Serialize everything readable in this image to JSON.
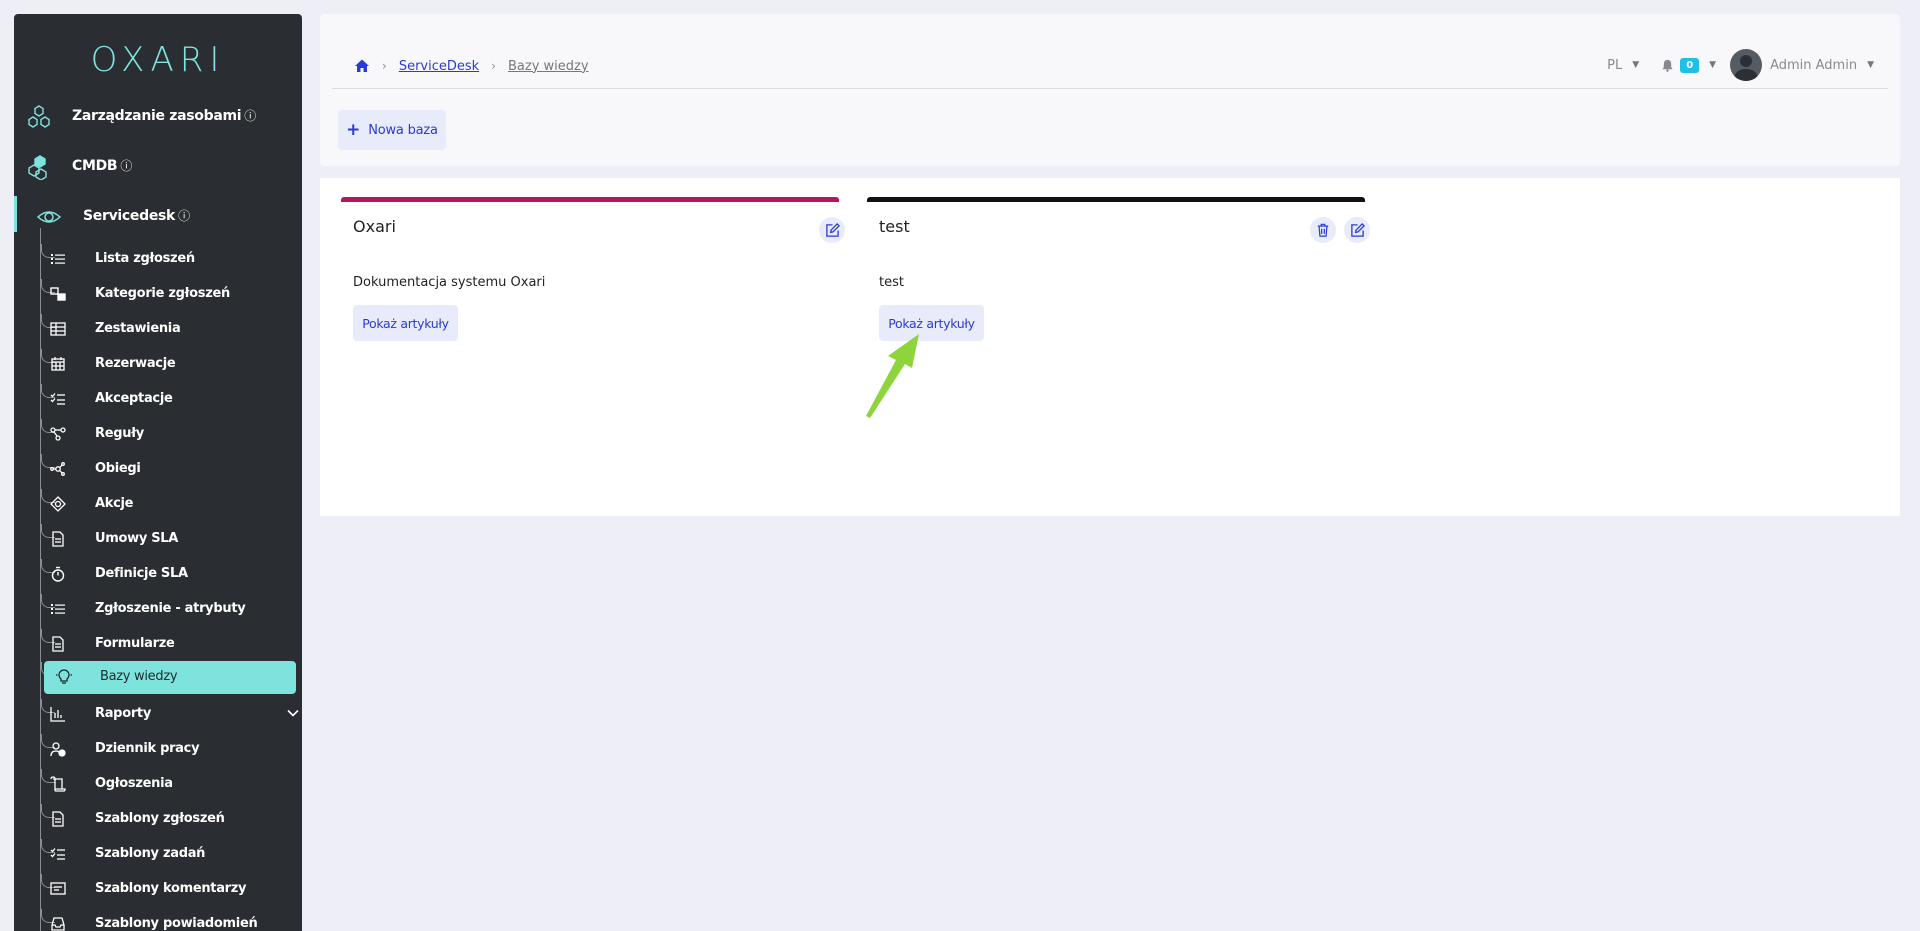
{
  "app": {
    "logo": "OXARI"
  },
  "sidebar": {
    "top_items": [
      {
        "label": "Zarządzanie zasobami",
        "info": "ⓘ",
        "icon": "hexagons-icon"
      },
      {
        "label": "CMDB",
        "info": "ⓘ",
        "icon": "cubes-icon"
      },
      {
        "label": "Servicedesk",
        "info": "ⓘ",
        "icon": "eye-target-icon"
      }
    ],
    "sub_items": [
      {
        "label": "Lista zgłoszeń",
        "icon": "list-icon"
      },
      {
        "label": "Kategorie zgłoszeń",
        "icon": "categories-icon"
      },
      {
        "label": "Zestawienia",
        "icon": "table-icon"
      },
      {
        "label": "Rezerwacje",
        "icon": "calendar-icon"
      },
      {
        "label": "Akceptacje",
        "icon": "checklist-icon"
      },
      {
        "label": "Reguły",
        "icon": "nodes-icon"
      },
      {
        "label": "Obiegi",
        "icon": "network-icon"
      },
      {
        "label": "Akcje",
        "icon": "target-icon"
      },
      {
        "label": "Umowy SLA",
        "icon": "document-icon"
      },
      {
        "label": "Definicje SLA",
        "icon": "stopwatch-icon"
      },
      {
        "label": "Zgłoszenie - atrybuty",
        "icon": "list-icon"
      },
      {
        "label": "Formularze",
        "icon": "form-icon"
      },
      {
        "label": "Bazy wiedzy",
        "icon": "lightbulb-icon"
      },
      {
        "label": "Raporty",
        "icon": "chart-icon"
      },
      {
        "label": "Dziennik pracy",
        "icon": "user-clock-icon"
      },
      {
        "label": "Ogłoszenia",
        "icon": "scroll-icon"
      },
      {
        "label": "Szablony zgłoszeń",
        "icon": "document-icon"
      },
      {
        "label": "Szablony zadań",
        "icon": "checklist-icon"
      },
      {
        "label": "Szablony komentarzy",
        "icon": "comment-icon"
      },
      {
        "label": "Szablony powiadomień",
        "icon": "inbox-icon"
      }
    ]
  },
  "header": {
    "breadcrumb": [
      "ServiceDesk",
      "Bazy wiedzy"
    ],
    "language": "PL",
    "notifications": "0",
    "user": "Admin Admin",
    "new_button": "Nowa baza"
  },
  "knowledge_bases": [
    {
      "name": "Oxari",
      "description": "Dokumentacja systemu Oxari",
      "button": "Pokaż artykuły",
      "color": "#b5165f"
    },
    {
      "name": "test",
      "description": "test",
      "button": "Pokaż artykuły",
      "color": "#111111"
    }
  ],
  "colors": {
    "accent": "#7fe3dd",
    "primary": "#2b3bd1",
    "sidebar": "#2a2d32"
  }
}
